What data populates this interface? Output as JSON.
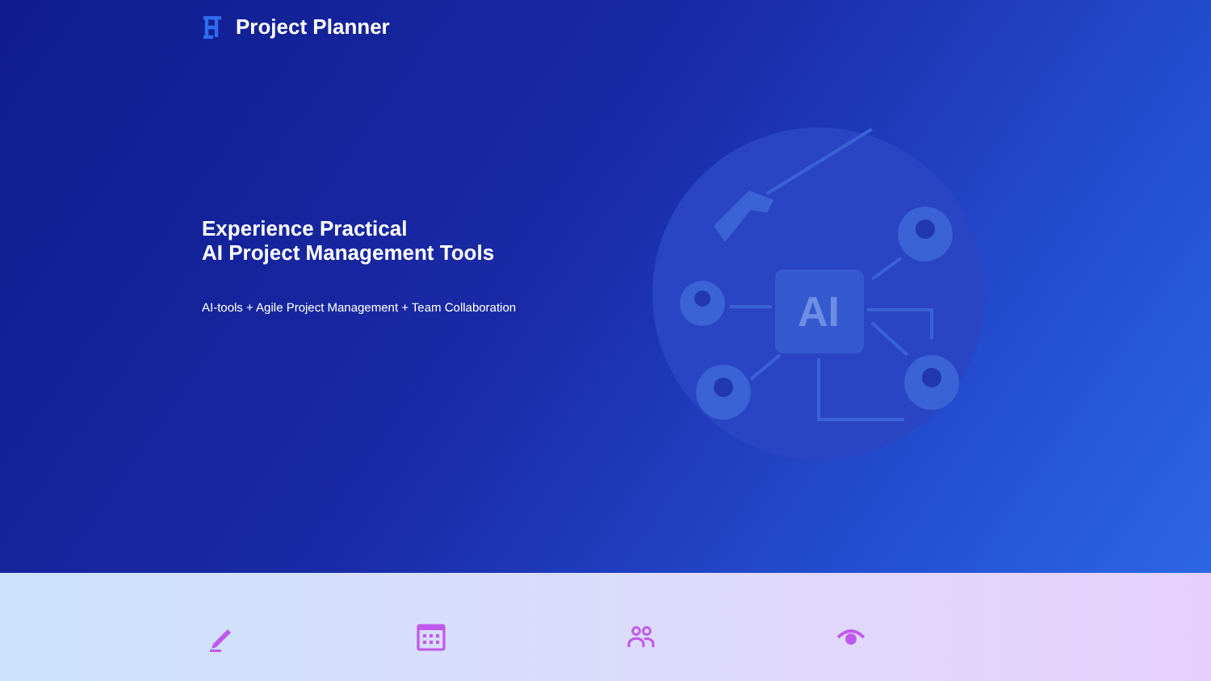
{
  "header": {
    "brand": "Project Planner"
  },
  "hero": {
    "title_lines": [
      "Experience Practical",
      "AI Project Management Tools"
    ],
    "subtitle": "AI-tools + Agile Project Management + Team Collaboration",
    "illustration_label": "AI"
  },
  "features": [
    {
      "kind": "pencil"
    },
    {
      "kind": "calendar"
    },
    {
      "kind": "people"
    },
    {
      "kind": "eye"
    }
  ]
}
